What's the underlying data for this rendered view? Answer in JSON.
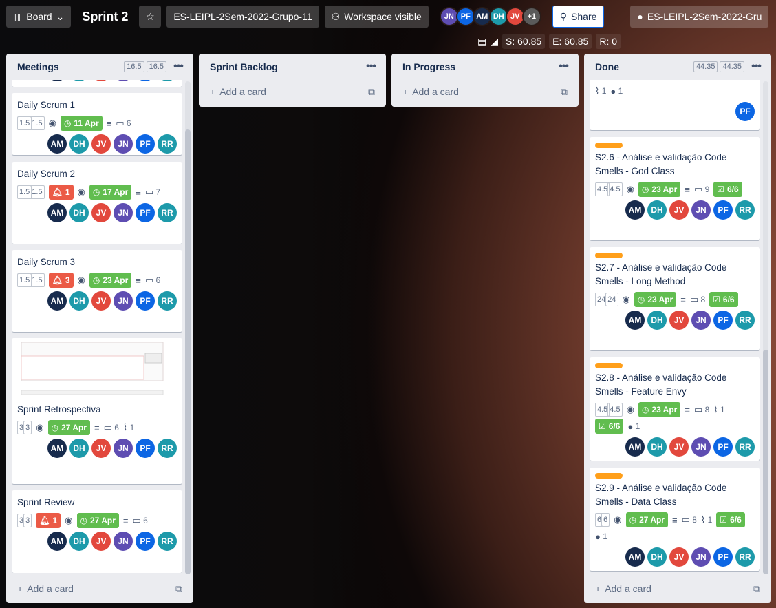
{
  "topbar": {
    "view_switcher": "Board",
    "board_title": "Sprint 2",
    "workspace": "ES-LEIPL-2Sem-2022-Grupo-11",
    "visibility": "Workspace visible",
    "avatars": [
      {
        "initials": "JN",
        "color": "#5e4db2"
      },
      {
        "initials": "PF",
        "color": "#0c66e4"
      },
      {
        "initials": "AM",
        "color": "#172b4d"
      },
      {
        "initials": "DH",
        "color": "#1d9aaa"
      },
      {
        "initials": "JV",
        "color": "#e2483d"
      }
    ],
    "more_members": "+1",
    "share": "Share",
    "github_repo": "ES-LEIPL-2Sem-2022-Gru"
  },
  "subbar": {
    "s": "S: 60.85",
    "e": "E: 60.85",
    "r": "R: 0"
  },
  "members": [
    "AM",
    "DH",
    "JV",
    "JN",
    "PF",
    "RR"
  ],
  "member_colors": {
    "AM": "#172b4d",
    "DH": "#1d9aaa",
    "JV": "#e2483d",
    "JN": "#5e4db2",
    "PF": "#0c66e4",
    "RR": "#1d9aaa"
  },
  "lists": {
    "meetings": {
      "title": "Meetings",
      "est_a": "16.5",
      "est_b": "16.5",
      "add": "Add a card",
      "cards": [
        {
          "title": "Daily Scrum 1",
          "est": [
            "1.5",
            "1.5"
          ],
          "due": "11 Apr",
          "comments": "6"
        },
        {
          "title": "Daily Scrum 2",
          "est": [
            "1.5",
            "1.5"
          ],
          "alert": "1",
          "due": "17 Apr",
          "comments": "7"
        },
        {
          "title": "Daily Scrum 3",
          "est": [
            "1.5",
            "1.5"
          ],
          "alert": "3",
          "due": "23 Apr",
          "comments": "6"
        },
        {
          "title": "Sprint Retrospectiva",
          "est": [
            "3",
            "3"
          ],
          "due": "27 Apr",
          "comments": "6",
          "attachments": "1"
        },
        {
          "title": "Sprint Review",
          "est": [
            "3",
            "3"
          ],
          "alert": "1",
          "due": "27 Apr",
          "comments": "6"
        }
      ]
    },
    "backlog": {
      "title": "Sprint Backlog",
      "add": "Add a card"
    },
    "progress": {
      "title": "In Progress",
      "add": "Add a card"
    },
    "done": {
      "title": "Done",
      "est_a": "44.35",
      "est_b": "44.35",
      "add": "Add a card",
      "top_card": {
        "attachments": "1",
        "github": "1",
        "member": "PF"
      },
      "cards": [
        {
          "title": "S2.6 - Análise e validação Code Smells - God Class",
          "est": [
            "4.5",
            "4.5"
          ],
          "due": "23 Apr",
          "comments": "9",
          "checklist": "6/6"
        },
        {
          "title": "S2.7 - Análise e validação Code Smells - Long Method",
          "est": [
            "24",
            "24"
          ],
          "due": "23 Apr",
          "comments": "8",
          "checklist": "6/6"
        },
        {
          "title": "S2.8 - Análise e validação Code Smells - Feature Envy",
          "est": [
            "4.5",
            "4.5"
          ],
          "due": "23 Apr",
          "comments": "8",
          "attachments": "1",
          "checklist": "6/6",
          "github": "1"
        },
        {
          "title": "S2.9 - Análise e validação Code Smells - Data Class",
          "est": [
            "6",
            "6"
          ],
          "due": "27 Apr",
          "comments": "8",
          "attachments": "1",
          "checklist": "6/6",
          "github": "1"
        }
      ]
    }
  }
}
